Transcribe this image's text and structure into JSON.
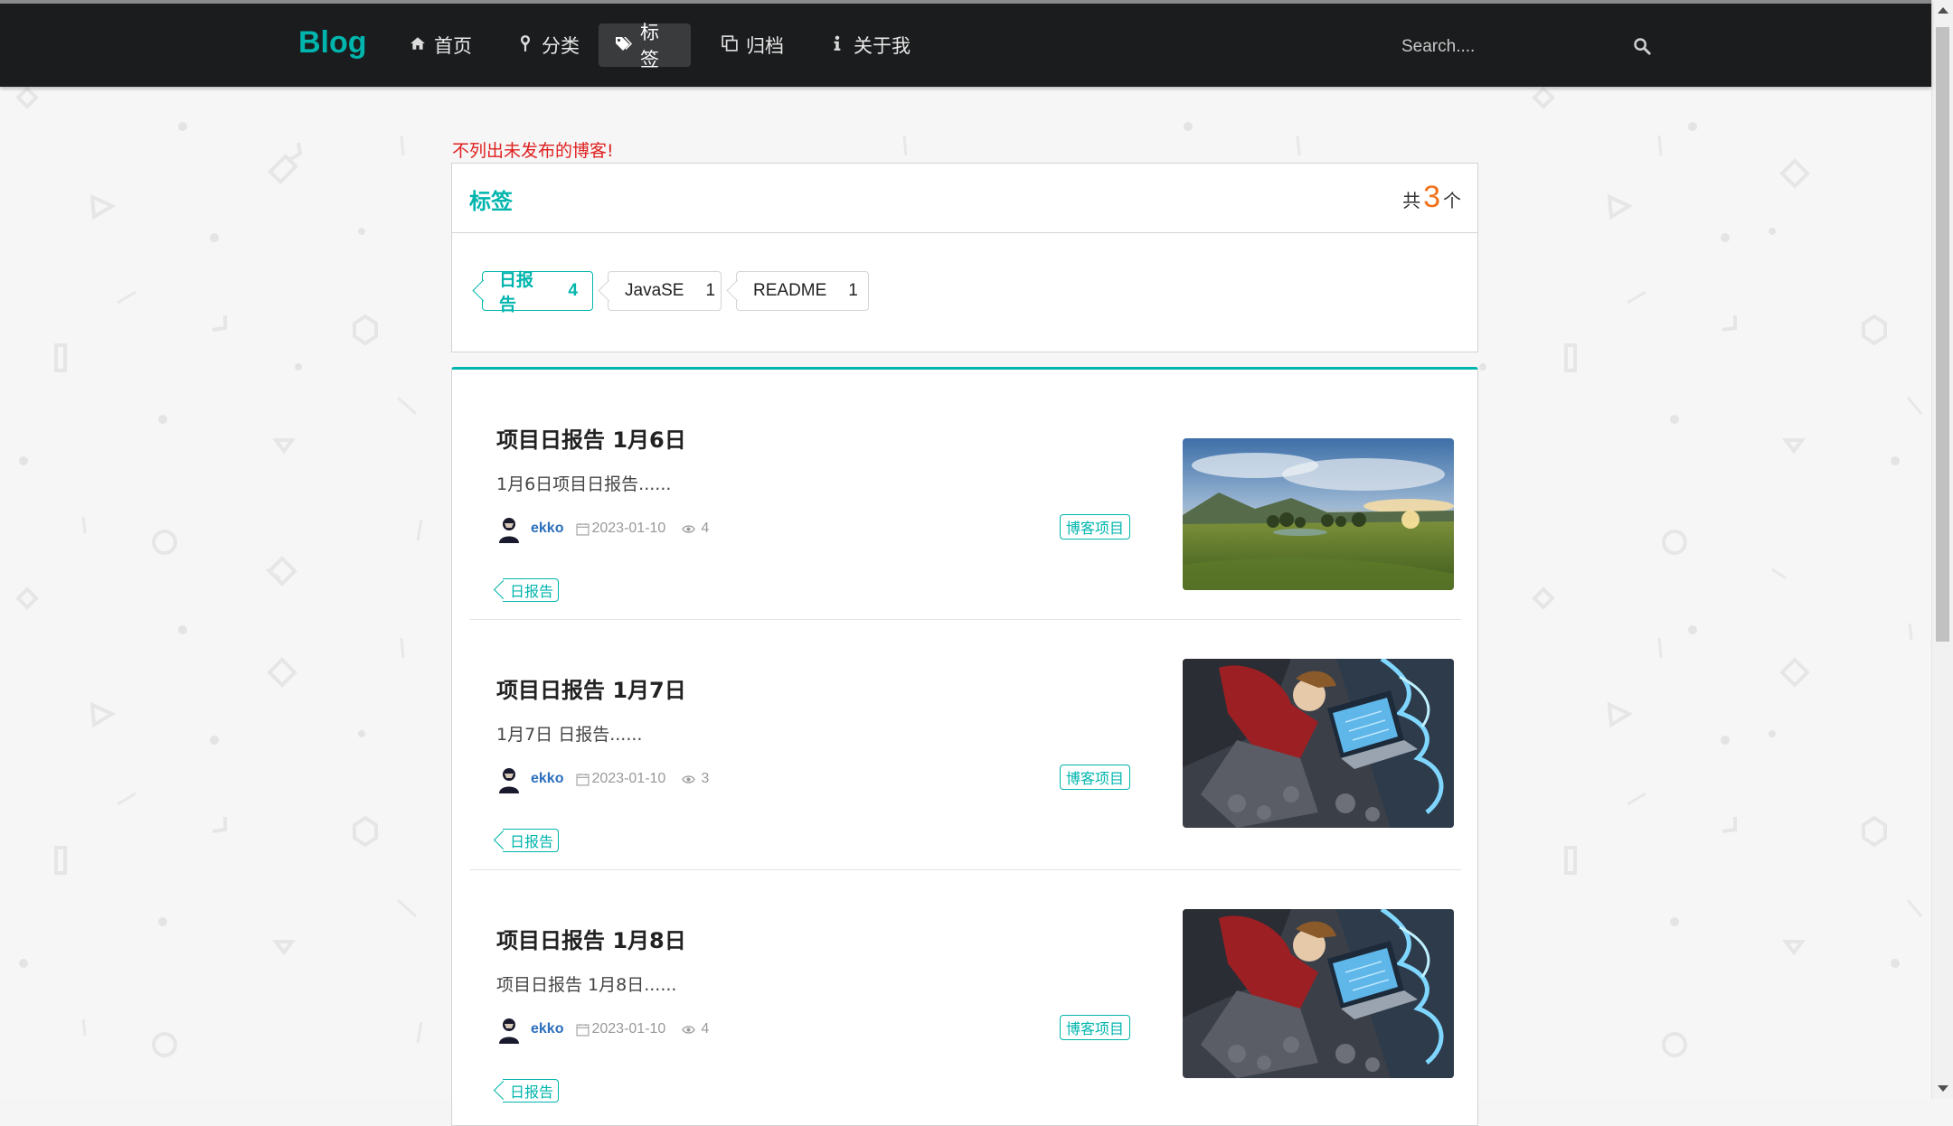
{
  "navbar": {
    "brand": "Blog",
    "items": [
      {
        "label": "首页",
        "icon": "home-icon",
        "active": false
      },
      {
        "label": "分类",
        "icon": "map-pin-icon",
        "active": false
      },
      {
        "label": "标签",
        "icon": "tags-icon",
        "active": true
      },
      {
        "label": "归档",
        "icon": "clone-icon",
        "active": false
      },
      {
        "label": "关于我",
        "icon": "info-icon",
        "active": false
      }
    ],
    "search_placeholder": "Search....",
    "search_icon": "search-icon"
  },
  "notice": "不列出未发布的博客!",
  "tag_header": {
    "title": "标签",
    "count_prefix": "共",
    "count": "3",
    "count_suffix": "个"
  },
  "tags": [
    {
      "name": "日报告",
      "count": "4",
      "active": true
    },
    {
      "name": "JavaSE",
      "count": "1",
      "active": false
    },
    {
      "name": "README",
      "count": "1",
      "active": false
    }
  ],
  "posts": [
    {
      "title": "项目日报告 1月6日",
      "excerpt": "1月6日项目日报告......",
      "author": "ekko",
      "date": "2023-01-10",
      "views": "4",
      "category": "博客项目",
      "tag": "日报告",
      "image": "landscape-meadow-sunset"
    },
    {
      "title": "项目日报告 1月7日",
      "excerpt": "1月7日 日报告......",
      "author": "ekko",
      "date": "2023-01-10",
      "views": "3",
      "category": "博客项目",
      "tag": "日报告",
      "image": "anime-figure-laptop"
    },
    {
      "title": "项目日报告 1月8日",
      "excerpt": "项目日报告 1月8日......",
      "author": "ekko",
      "date": "2023-01-10",
      "views": "4",
      "category": "博客项目",
      "tag": "日报告",
      "image": "anime-figure-laptop"
    }
  ],
  "colors": {
    "accent": "#00b5ad",
    "navbar": "#1b1c1d",
    "notice": "#e02020",
    "count": "#f2711c",
    "author": "#2b6fbd"
  }
}
